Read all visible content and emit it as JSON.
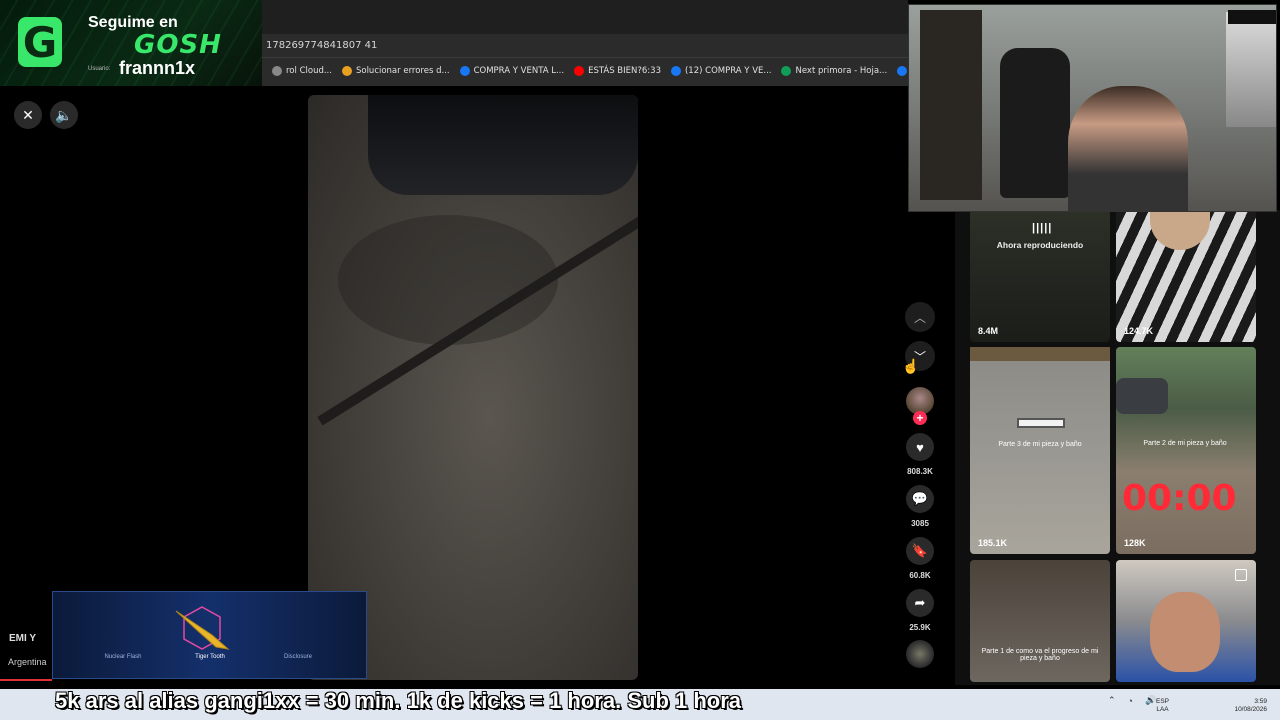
{
  "browser": {
    "url": "178269774841807 41",
    "bookmarks": [
      {
        "label": "rol Cloud...",
        "color": "#888888"
      },
      {
        "label": "Solucionar errores d...",
        "color": "#e8a020"
      },
      {
        "label": "COMPRA Y VENTA L...",
        "color": "#1877f2"
      },
      {
        "label": "ESTÁS BIEN?6:33",
        "color": "#ff0000"
      },
      {
        "label": "(12) COMPRA Y VE...",
        "color": "#1877f2"
      },
      {
        "label": "Next primora - Hoja...",
        "color": "#0f9d58"
      },
      {
        "label": "(12) COMPRA Y VE...",
        "color": "#1877f2"
      }
    ]
  },
  "badge": {
    "logo_letter": "G",
    "line1": "Seguime en",
    "brand": "GOSH",
    "user_label": "Usuario:",
    "username": "frannn1x"
  },
  "player": {
    "close_icon": "✕",
    "sound_icon": "🔈"
  },
  "actions": {
    "likes": "808.3K",
    "comments": "3085",
    "saves": "60.8K",
    "shares": "25.9K"
  },
  "grid": {
    "now_playing": "Ahora reproduciendo",
    "tiles": [
      {
        "count": "8.4M"
      },
      {
        "count": "124.7K"
      },
      {
        "count": "185.1K",
        "caption": "Parte 3 de mi pieza y baño"
      },
      {
        "count": "128K",
        "caption": "Parte 2 de mi pieza y baño",
        "timer": "00:00"
      },
      {
        "caption": "Parte 1 de como va el progreso de mi pieza y baño"
      },
      {}
    ]
  },
  "overlay": {
    "user_tag": "EMI Y",
    "country": "Argentina",
    "skin_labels": [
      "Nuclear Flash",
      "Tiger Tooth",
      "Disclosure"
    ]
  },
  "webcam": {
    "overlay": "streamer"
  },
  "ticker": "5k ars al alias gangi1xx = 30 min. 1k de kicks = 1 hora. Sub 1 hora",
  "taskbar": {
    "lang_top": "ESP",
    "lang_bottom": "LAA",
    "time": "3:59",
    "date": "10/08/2026"
  },
  "colors": {
    "brand_green": "#39e86a",
    "like_red": "#fe2c55",
    "timer_red": "#ff2a36"
  }
}
